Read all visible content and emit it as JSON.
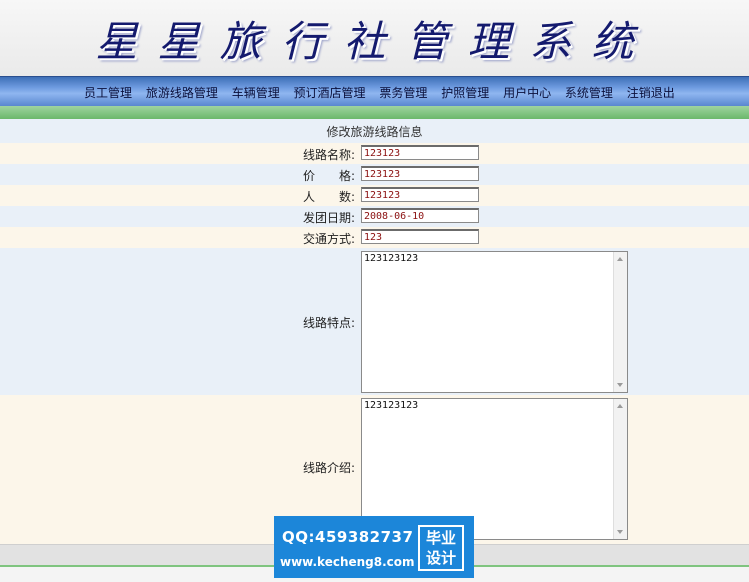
{
  "header": {
    "title": "星星旅行社管理系统"
  },
  "nav": [
    "员工管理",
    "旅游线路管理",
    "车辆管理",
    "预订酒店管理",
    "票务管理",
    "护照管理",
    "用户中心",
    "系统管理",
    "注销退出"
  ],
  "form": {
    "title": "修改旅游线路信息",
    "fields": {
      "name": {
        "label": "线路名称:",
        "value": "123123"
      },
      "price": {
        "label": "价　　格:",
        "value": "123123"
      },
      "people": {
        "label": "人　　数:",
        "value": "123123"
      },
      "date": {
        "label": "发团日期:",
        "value": "2008-06-10"
      },
      "traffic": {
        "label": "交通方式:",
        "value": "123"
      },
      "features": {
        "label": "线路特点:",
        "value": "123123123"
      },
      "intro": {
        "label": "线路介绍:",
        "value": "123123123"
      }
    }
  },
  "watermark": {
    "qq": "QQ:459382737",
    "url": "www.kecheng8.com",
    "badge_line1": "毕业",
    "badge_line2": "设计"
  },
  "colors": {
    "title": "#141a6e",
    "navbar": "#5f8fd8",
    "green_bar": "#7fc47f",
    "row_blue": "#e9f0f8",
    "row_cream": "#fcf6ea",
    "input_text": "#8b1010",
    "watermark_bg": "#1c86d9"
  }
}
